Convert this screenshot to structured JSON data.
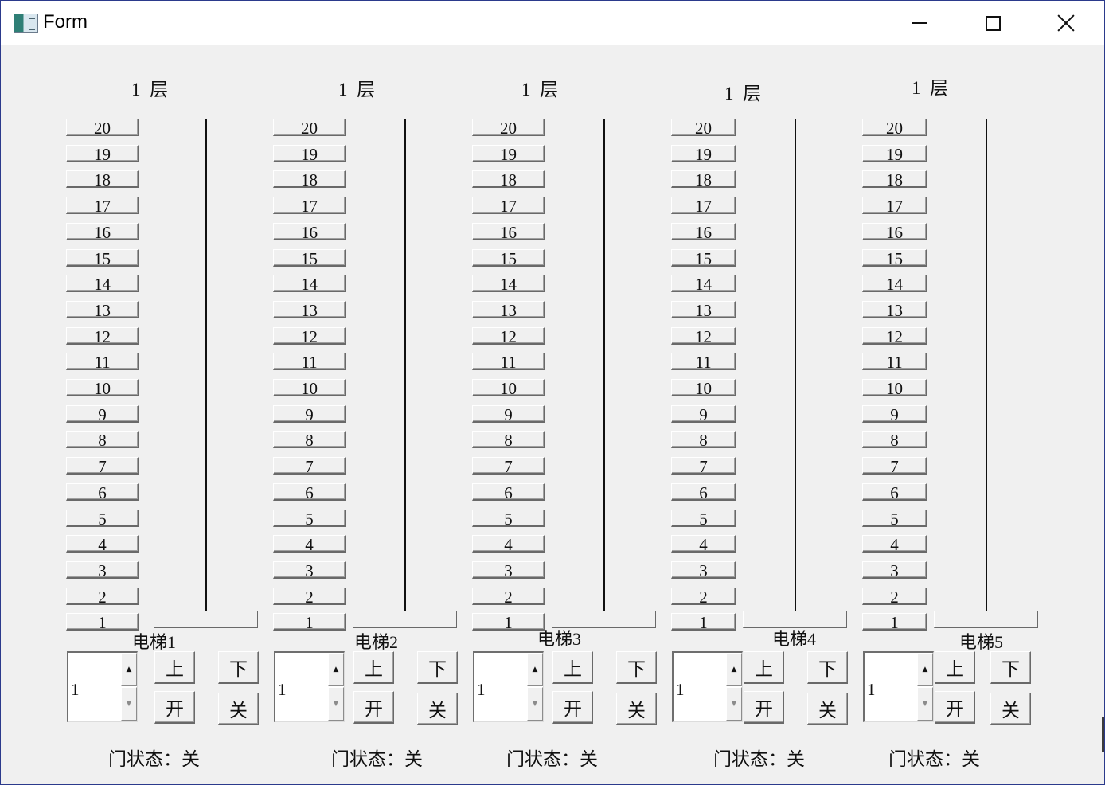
{
  "window": {
    "title": "Form",
    "icon": "form-app-icon",
    "controls": {
      "minimize": "minimize-icon",
      "maximize": "maximize-icon",
      "close": "close-icon"
    }
  },
  "floor_labels": [
    "20",
    "19",
    "18",
    "17",
    "16",
    "15",
    "14",
    "13",
    "12",
    "11",
    "10",
    "9",
    "8",
    "7",
    "6",
    "5",
    "4",
    "3",
    "2",
    "1"
  ],
  "elevators": [
    {
      "name": "电梯1",
      "floor_display": "1  层",
      "spin_value": "1",
      "up": "上",
      "down": "下",
      "open": "开",
      "close": "关",
      "door_status": "门状态：关"
    },
    {
      "name": "电梯2",
      "floor_display": "1  层",
      "spin_value": "1",
      "up": "上",
      "down": "下",
      "open": "开",
      "close": "关",
      "door_status": "门状态：关"
    },
    {
      "name": "电梯3",
      "floor_display": "1  层",
      "spin_value": "1",
      "up": "上",
      "down": "下",
      "open": "开",
      "close": "关",
      "door_status": "门状态：关"
    },
    {
      "name": "电梯4",
      "floor_display": "1  层",
      "spin_value": "1",
      "up": "上",
      "down": "下",
      "open": "开",
      "close": "关",
      "door_status": "门状态：关"
    },
    {
      "name": "电梯5",
      "floor_display": "1  层",
      "spin_value": "1",
      "up": "上",
      "down": "下",
      "open": "开",
      "close": "关",
      "door_status": "门状态：关"
    }
  ],
  "spin_icons": {
    "up": "spin-up-arrow-icon",
    "down": "spin-down-arrow-icon"
  }
}
